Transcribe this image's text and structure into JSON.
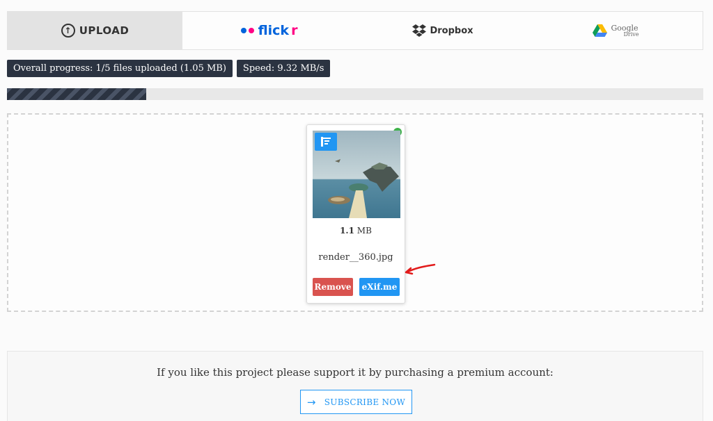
{
  "providers": {
    "upload_label": "UPLOAD",
    "flickr_label": "flick",
    "flickr_label_r": "r",
    "dropbox_label": "Dropbox",
    "google_label": "Google",
    "google_sub": "Drive"
  },
  "status": {
    "overall_progress": "Overall progress: 1/5 files uploaded (1.05 MB)",
    "speed": "Speed: 9.32 MB/s",
    "progress_fraction": 0.2
  },
  "file": {
    "size_value": "1.1",
    "size_unit": "MB",
    "name": "render__360.jpg",
    "remove_label": "Remove",
    "exif_label": "eXif.me"
  },
  "support": {
    "text": "If you like this project please support it by purchasing a premium account:",
    "subscribe_label": "SUBSCRIBE NOW"
  },
  "colors": {
    "dark": "#2b3341",
    "accent": "#2196f3",
    "danger": "#d9534f",
    "success": "#3fb24a",
    "annotation": "#e21b1b"
  },
  "icons": [
    "upload-icon",
    "flickr-icon",
    "dropbox-icon",
    "google-drive-icon",
    "check-icon",
    "image-tools-icon",
    "arrow-right-icon"
  ]
}
